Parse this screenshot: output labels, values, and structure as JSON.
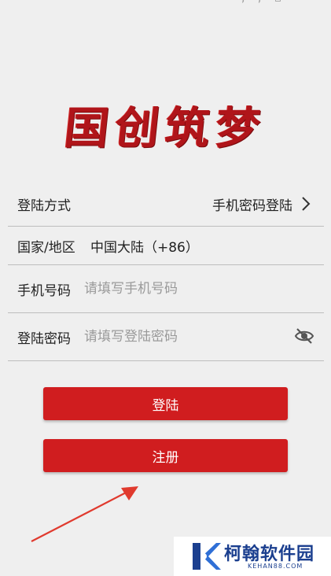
{
  "status_bar": {
    "glyphs": "'  ◦  ,  ,  ▫"
  },
  "app": {
    "logo_text": "国创筑梦"
  },
  "form": {
    "login_method": {
      "label": "登陆方式",
      "value": "手机密码登陆"
    },
    "region": {
      "label": "国家/地区",
      "value": "中国大陆（+86）"
    },
    "phone": {
      "label": "手机号码",
      "placeholder": "请填写手机号码",
      "value": ""
    },
    "password": {
      "label": "登陆密码",
      "placeholder": "请填写登陆密码",
      "value": ""
    }
  },
  "buttons": {
    "login": "登陆",
    "register": "注册"
  },
  "watermark": {
    "title": "柯翰软件园",
    "subtitle": "KEHAN88.COM"
  },
  "colors": {
    "accent": "#d01d1f",
    "logo": "#b0151a",
    "watermark": "#1b3f8f",
    "background": "#efefef"
  },
  "icons": {
    "chevron": "chevron-right-icon",
    "eye": "eye-off-icon",
    "arrow": "red-annotation-arrow",
    "watermark_logo": "kehan-logo-icon"
  }
}
